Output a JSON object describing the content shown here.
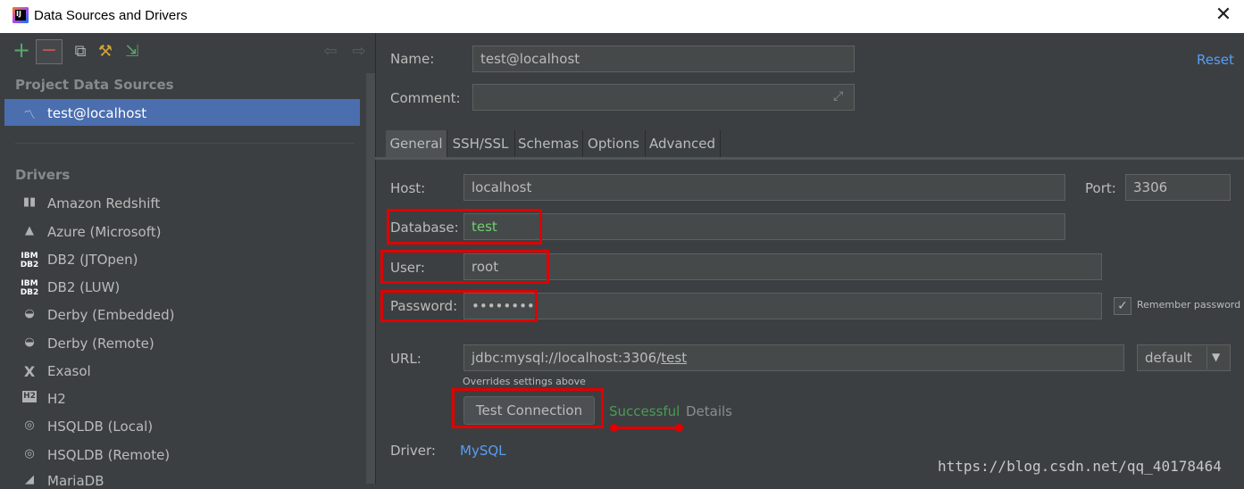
{
  "window": {
    "title": "Data Sources and Drivers",
    "close_glyph": "✕"
  },
  "sidebar": {
    "project_section": "Project Data Sources",
    "data_sources": [
      {
        "label": "test@localhost",
        "icon": "mysql-dolphin-icon"
      }
    ],
    "drivers_section": "Drivers",
    "drivers": [
      {
        "label": "Amazon Redshift",
        "icon": "redshift-icon"
      },
      {
        "label": "Azure (Microsoft)",
        "icon": "azure-icon"
      },
      {
        "label": "DB2 (JTOpen)",
        "icon": "ibm-db2-icon"
      },
      {
        "label": "DB2 (LUW)",
        "icon": "ibm-db2-icon"
      },
      {
        "label": "Derby (Embedded)",
        "icon": "derby-hat-icon"
      },
      {
        "label": "Derby (Remote)",
        "icon": "derby-hat-icon"
      },
      {
        "label": "Exasol",
        "icon": "exasol-icon"
      },
      {
        "label": "H2",
        "icon": "h2-icon"
      },
      {
        "label": "HSQLDB (Local)",
        "icon": "hsqldb-icon"
      },
      {
        "label": "HSQLDB (Remote)",
        "icon": "hsqldb-icon"
      },
      {
        "label": "MariaDB",
        "icon": "mariadb-icon"
      }
    ]
  },
  "form": {
    "name_label": "Name:",
    "name_value": "test@localhost",
    "comment_label": "Comment:",
    "comment_value": "",
    "reset_label": "Reset",
    "tabs": [
      "General",
      "SSH/SSL",
      "Schemas",
      "Options",
      "Advanced"
    ],
    "active_tab": "General",
    "host_label": "Host:",
    "host_value": "localhost",
    "port_label": "Port:",
    "port_value": "3306",
    "database_label": "Database:",
    "database_value": "test",
    "user_label": "User:",
    "user_value": "root",
    "password_label": "Password:",
    "password_value": "••••••••",
    "remember_password_label": "Remember password",
    "remember_password_checked": true,
    "url_label": "URL:",
    "url_prefix": "jdbc:mysql://localhost:3306/",
    "url_db": "test",
    "url_mode": "default",
    "url_hint": "Overrides settings above",
    "test_connection_label": "Test Connection",
    "status_text": "Successful",
    "details_label": "Details",
    "driver_label": "Driver:",
    "driver_value": "MySQL"
  },
  "watermark": "https://blog.csdn.net/qq_40178464",
  "colors": {
    "accent": "#589df6",
    "success": "#499c54",
    "highlight": "#e00000",
    "selection": "#4b6eaf",
    "database_value": "#6fd06f"
  }
}
